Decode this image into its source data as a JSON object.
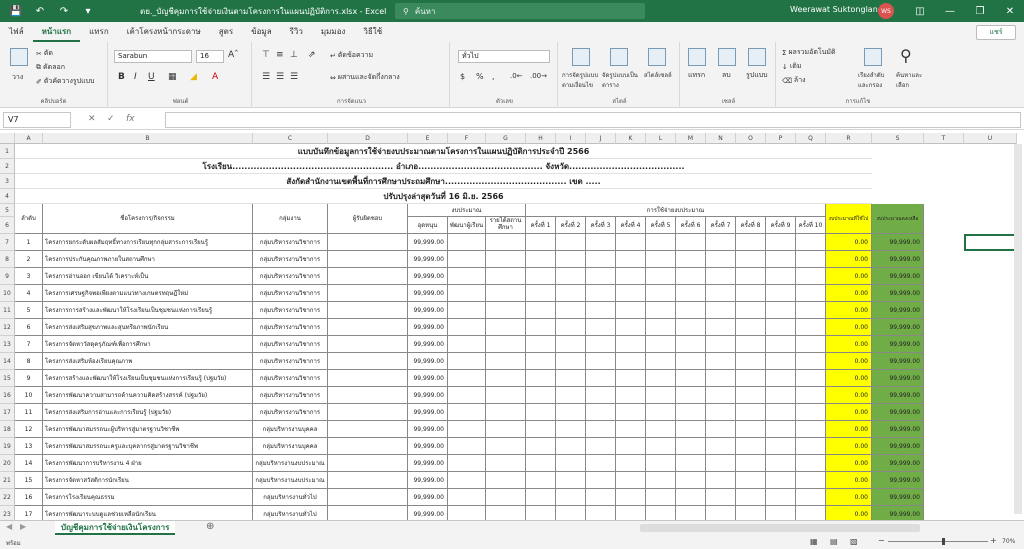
{
  "window": {
    "title": "ตย._บัญชีคุมการใช้จ่ายเงินตามโครงการในแผนปฏิบัติการ.xlsx - Excel",
    "search_placeholder": "ค้นหา",
    "user_name": "Weerawat Suktonglang",
    "user_initials": "WS"
  },
  "tabs": [
    "ไฟล์",
    "หน้าแรก",
    "แทรก",
    "เค้าโครงหน้ากระดาษ",
    "สูตร",
    "ข้อมูล",
    "รีวิว",
    "มุมมอง",
    "วิธีใช้"
  ],
  "share_label": "แชร์",
  "ribbon": {
    "clipboard": {
      "label": "คลิปบอร์ด",
      "cut": "ตัด",
      "copy": "คัดลอก",
      "format_painter": "ตัวคัดวางรูปแบบ",
      "paste": "วาง"
    },
    "font": {
      "label": "ฟอนต์",
      "name": "Sarabun",
      "size": "16"
    },
    "alignment": {
      "label": "การจัดแนว",
      "wrap": "ตัดข้อความ",
      "merge": "ผสานและจัดกึ่งกลาง"
    },
    "number": {
      "label": "ตัวเลข",
      "format": "ทั่วไป"
    },
    "styles": {
      "label": "สไตล์",
      "cond": "การจัดรูปแบบตามเงื่อนไข",
      "table": "จัดรูปแบบเป็นตาราง",
      "cell": "สไตล์เซลล์"
    },
    "cells": {
      "label": "เซลล์",
      "insert": "แทรก",
      "delete": "ลบ",
      "format": "รูปแบบ"
    },
    "editing": {
      "label": "การแก้ไข",
      "autosum": "ผลรวมอัตโนมัติ",
      "fill": "เติม",
      "clear": "ล้าง",
      "sort": "เรียงลำดับและกรอง",
      "find": "ค้นหาและเลือก"
    }
  },
  "formula_bar": {
    "name_box": "V7",
    "fx": "fx"
  },
  "columns": [
    "A",
    "B",
    "C",
    "D",
    "E",
    "F",
    "G",
    "H",
    "I",
    "J",
    "K",
    "L",
    "M",
    "N",
    "O",
    "P",
    "Q",
    "R",
    "S",
    "T",
    "U"
  ],
  "row_numbers": [
    "1",
    "2",
    "3",
    "4",
    "5",
    "6",
    "7",
    "8",
    "9",
    "10",
    "11",
    "12",
    "13",
    "14",
    "15",
    "16",
    "17",
    "18",
    "19",
    "20",
    "21",
    "22",
    "23",
    "24",
    "25"
  ],
  "sheet": {
    "title1": "แบบบันทึกข้อมูลการใช้จ่ายงบประมาณตามโครงการในแผนปฏิบัติการประจำปี 2566",
    "title2": "โรงเรียน..................................................... อำเภอ......................................... จังหวัด......................................",
    "title3": "สังกัดสำนักงานเขตพื้นที่การศึกษาประถมศึกษา........................................ เขต .....",
    "title4": "ปรับปรุงล่าสุดวันที่ 16 มิ.ย. 2566",
    "headers": {
      "no": "ลำดับ",
      "project": "ชื่อโครงการ/กิจกรรม",
      "group": "กลุ่มงาน",
      "owner": "ผู้รับผิดชอบ",
      "budget": "งบประมาณ",
      "subsidy": "อุดหนุน",
      "dev": "พัฒนาผู้เรียน",
      "income": "รายได้สถานศึกษา",
      "usage": "การใช้จ่ายงบประมาณ",
      "times": [
        "ครั้งที่ 1",
        "ครั้งที่ 2",
        "ครั้งที่ 3",
        "ครั้งที่ 4",
        "ครั้งที่ 5",
        "ครั้งที่ 6",
        "ครั้งที่ 7",
        "ครั้งที่ 8",
        "ครั้งที่ 9",
        "ครั้งที่ 10"
      ],
      "used": "งบประมาณที่ใช้ไป",
      "remain": "งบประมาณคงเหลือ"
    },
    "rows": [
      {
        "no": "1",
        "project": "โครงการยกระดับผลสัมฤทธิ์ทางการเรียนทุกกลุ่มสาระการเรียนรู้",
        "group": "กลุ่มบริหารงานวิชาการ",
        "subsidy": "99,999.00",
        "used": "0.00",
        "remain": "99,999.00"
      },
      {
        "no": "2",
        "project": "โครงการประกันคุณภาพภายในสถานศึกษา",
        "group": "กลุ่มบริหารงานวิชาการ",
        "subsidy": "99,999.00",
        "used": "0.00",
        "remain": "99,999.00"
      },
      {
        "no": "3",
        "project": "โครงการอ่านออก เขียนได้ วิเคราะห์เป็น",
        "group": "กลุ่มบริหารงานวิชาการ",
        "subsidy": "99,999.00",
        "used": "0.00",
        "remain": "99,999.00"
      },
      {
        "no": "4",
        "project": "โครงการเศรษฐกิจพอเพียงตามแนวทางเกษตรทฤษฎีใหม่",
        "group": "กลุ่มบริหารงานวิชาการ",
        "subsidy": "99,999.00",
        "used": "0.00",
        "remain": "99,999.00"
      },
      {
        "no": "5",
        "project": "โครงการการสร้างและพัฒนาให้โรงเรียนเป็นชุมชนแห่งการเรียนรู้",
        "group": "กลุ่มบริหารงานวิชาการ",
        "subsidy": "99,999.00",
        "used": "0.00",
        "remain": "99,999.00"
      },
      {
        "no": "6",
        "project": "โครงการส่งเสริมสุขภาพและสุนทรียภาพนักเรียน",
        "group": "กลุ่มบริหารงานวิชาการ",
        "subsidy": "99,999.00",
        "used": "0.00",
        "remain": "99,999.00"
      },
      {
        "no": "7",
        "project": "โครงการจัดหาวัสดุครุภัณฑ์เพื่อการศึกษา",
        "group": "กลุ่มบริหารงานวิชาการ",
        "subsidy": "99,999.00",
        "used": "0.00",
        "remain": "99,999.00"
      },
      {
        "no": "8",
        "project": "โครงการส่งเสริมห้องเรียนคุณภาพ",
        "group": "กลุ่มบริหารงานวิชาการ",
        "subsidy": "99,999.00",
        "used": "0.00",
        "remain": "99,999.00"
      },
      {
        "no": "9",
        "project": "โครงการสร้างและพัฒนาให้โรงเรียนเป็นชุมชนแห่งการเรียนรู้ (ปฐมวัย)",
        "group": "กลุ่มบริหารงานวิชาการ",
        "subsidy": "99,999.00",
        "used": "0.00",
        "remain": "99,999.00"
      },
      {
        "no": "10",
        "project": "โครงการพัฒนาความสามารถด้านความคิดสร้างสรรค์ (ปฐมวัย)",
        "group": "กลุ่มบริหารงานวิชาการ",
        "subsidy": "99,999.00",
        "used": "0.00",
        "remain": "99,999.00"
      },
      {
        "no": "11",
        "project": "โครงการส่งเสริมการอ่านและการเรียนรู้ (ปฐมวัย)",
        "group": "กลุ่มบริหารงานวิชาการ",
        "subsidy": "99,999.00",
        "used": "0.00",
        "remain": "99,999.00"
      },
      {
        "no": "12",
        "project": "โครงการพัฒนาสมรรถนะผู้บริหารสู่มาตรฐานวิชาชีพ",
        "group": "กลุ่มบริหารงานบุคคล",
        "subsidy": "99,999.00",
        "used": "0.00",
        "remain": "99,999.00"
      },
      {
        "no": "13",
        "project": "โครงการพัฒนาสมรรถนะครูและบุคลากรสู่มาตรฐานวิชาชีพ",
        "group": "กลุ่มบริหารงานบุคคล",
        "subsidy": "99,999.00",
        "used": "0.00",
        "remain": "99,999.00"
      },
      {
        "no": "14",
        "project": "โครงการพัฒนาการบริหารงาน 4 ฝ่าย",
        "group": "กลุ่มบริหารงานงบประมาณ",
        "subsidy": "99,999.00",
        "used": "0.00",
        "remain": "99,999.00"
      },
      {
        "no": "15",
        "project": "โครงการจัดหาสวัสดิการนักเรียน",
        "group": "กลุ่มบริหารงานงบประมาณ",
        "subsidy": "99,999.00",
        "used": "0.00",
        "remain": "99,999.00"
      },
      {
        "no": "16",
        "project": "โครงการโรงเรียนคุณธรรม",
        "group": "กลุ่มบริหารงานทั่วไป",
        "subsidy": "99,999.00",
        "used": "0.00",
        "remain": "99,999.00"
      },
      {
        "no": "17",
        "project": "โครงการพัฒนาระบบดูแลช่วยเหลือนักเรียน",
        "group": "กลุ่มบริหารงานทั่วไป",
        "subsidy": "99,999.00",
        "used": "0.00",
        "remain": "99,999.00"
      },
      {
        "no": "18",
        "project": "โครงการปรับปรุงภูมิทัศน์และพัฒนาแหล่งเรียนรู้ภายในสถานศึกษา",
        "group": "กลุ่มบริหารงานทั่วไป",
        "subsidy": "99,999.00",
        "used": "0.00",
        "remain": "99,999.00"
      },
      {
        "no": "19",
        "project": "โครงการโรงเรียนสีขาว",
        "group": "กลุ่มบริหารงานทั่วไป",
        "subsidy": "99,999.00",
        "used": "0.00",
        "remain": "99,999.00"
      }
    ]
  },
  "sheet_tab": "บัญชีคุมการใช้จ่ายเงินโครงการ",
  "status": {
    "ready": "พร้อม",
    "zoom": "70%"
  }
}
